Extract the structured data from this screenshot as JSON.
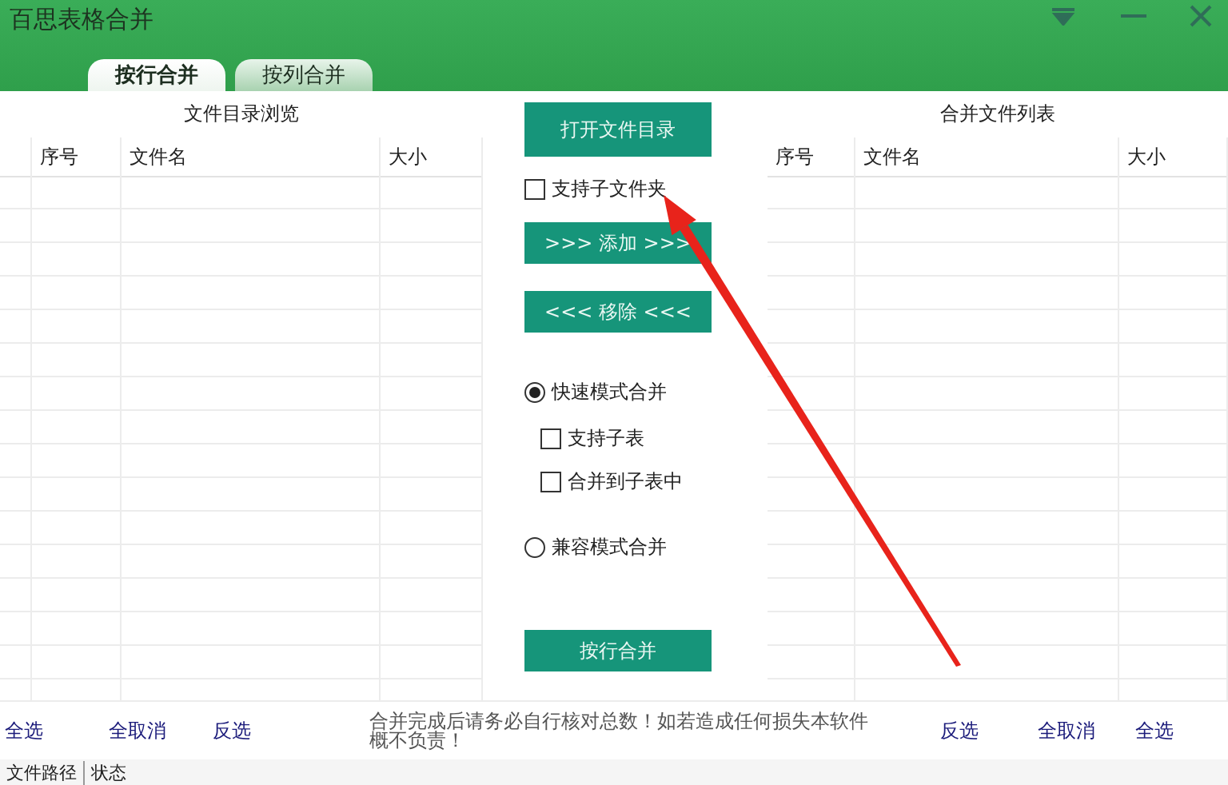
{
  "window": {
    "title": "百思表格合并"
  },
  "tabs": [
    {
      "label": "按行合并",
      "selected": true
    },
    {
      "label": "按列合并",
      "selected": false
    }
  ],
  "left_table": {
    "caption": "文件目录浏览",
    "columns": [
      "序号",
      "文件名",
      "大小"
    ]
  },
  "actions": [
    {
      "kind": "button",
      "label": "打开文件目录"
    },
    {
      "kind": "checkbox",
      "label": "支持子文件夹",
      "checked": false
    },
    {
      "kind": "button",
      "label": ">>> 添加 >>>"
    },
    {
      "kind": "button",
      "label": "<<< 移除 <<<"
    }
  ],
  "merge_modes": [
    {
      "label": "快速模式合并",
      "selected": true,
      "children": [
        {
          "label": "支持子表",
          "checked": false
        },
        {
          "label": "合并到子表中",
          "checked": false
        }
      ]
    },
    {
      "label": "兼容模式合并",
      "selected": false
    }
  ],
  "run_button": "按行合并",
  "right_table": {
    "caption": "合并文件列表",
    "columns": [
      "序号",
      "文件名",
      "大小"
    ]
  },
  "footer": {
    "left_links": [
      "全选",
      "全取消",
      "反选"
    ],
    "notice": "合并完成后请务必自行核对总数！如若造成任何损失本软件概不负责！",
    "right_links": [
      "反选",
      "全取消",
      "全选"
    ]
  },
  "status_columns": [
    "文件路径",
    "状态"
  ]
}
